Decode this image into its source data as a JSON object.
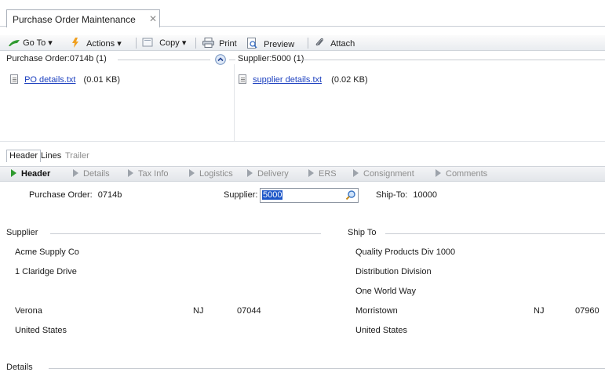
{
  "window": {
    "tab_title": "Purchase Order Maintenance",
    "close_glyph": "✕"
  },
  "toolbar": {
    "goto_label": "Go To",
    "actions_label": "Actions",
    "copy_label": "Copy",
    "print_label": "Print",
    "preview_label": "Preview",
    "attach_label": "Attach",
    "dropdown_glyph": "▾"
  },
  "attachments": {
    "po_pane_title": "Purchase Order:0714b (1)",
    "supplier_pane_title": "Supplier:5000 (1)",
    "po_file": {
      "name": "PO details.txt",
      "size": "(0.01 KB)"
    },
    "supplier_file": {
      "name": "supplier details.txt",
      "size": "(0.02 KB)"
    }
  },
  "subtabs": [
    "Header",
    "Lines",
    "Trailer"
  ],
  "sections": {
    "items": [
      "Header",
      "Details",
      "Tax Info",
      "Logistics",
      "Delivery",
      "ERS",
      "Consignment",
      "Comments"
    ]
  },
  "form": {
    "po_label": "Purchase Order:",
    "po_value": "0714b",
    "supplier_label": "Supplier:",
    "supplier_value": "5000",
    "shipto_label": "Ship-To:",
    "shipto_value": "10000"
  },
  "supplier_group": {
    "title": "Supplier",
    "name": "Acme Supply Co",
    "address1": "1 Claridge Drive",
    "city": "Verona",
    "state": "NJ",
    "zip": "07044",
    "country": "United States"
  },
  "shipto_group": {
    "title": "Ship To",
    "name": "Quality Products Div 1000",
    "address1": "Distribution Division",
    "address2": "One World Way",
    "city": "Morristown",
    "state": "NJ",
    "zip": "07960",
    "country": "United States"
  },
  "details_group": {
    "title": "Details"
  }
}
